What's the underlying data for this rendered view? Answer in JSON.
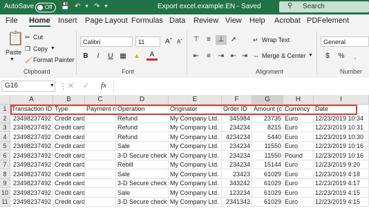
{
  "titlebar": {
    "autosave_label": "AutoSave",
    "autosave_state": "Off",
    "document_title": "Export excel.example.EN  -  Saved",
    "search_placeholder": "Search"
  },
  "menu": {
    "items": [
      "File",
      "Home",
      "Insert",
      "Page Layout",
      "Formulas",
      "Data",
      "Review",
      "View",
      "Help",
      "Acrobat",
      "PDFelement"
    ],
    "active": "Home"
  },
  "ribbon": {
    "clipboard": {
      "paste": "Paste",
      "cut": "Cut",
      "copy": "Copy",
      "format_painter": "Format Painter",
      "group_label": "Clipboard"
    },
    "font": {
      "family": "Calibri",
      "size": "11",
      "bold": "B",
      "italic": "I",
      "underline": "U",
      "font_color_glyph": "A",
      "group_label": "Font"
    },
    "alignment": {
      "wrap_text": "Wrap Text",
      "merge_center": "Merge & Center",
      "group_label": "Alignment"
    },
    "number": {
      "format": "General",
      "group_label": "Number"
    }
  },
  "formula_bar": {
    "name_box": "G16",
    "fx": "fx",
    "formula": ""
  },
  "sheet": {
    "columns": [
      "A",
      "B",
      "C",
      "D",
      "E",
      "F",
      "G",
      "H",
      "I"
    ],
    "selected_column": "G",
    "rows": [
      {
        "n": "1",
        "cells": [
          "Transaction ID",
          "Type",
          "Payment n",
          "Operation",
          "Originator",
          "Order ID",
          "Amount (c",
          "Currency",
          "Date"
        ]
      },
      {
        "n": "2",
        "cells": [
          "23498237492",
          "Credit card",
          "",
          "Refund",
          "My Company Ltd.",
          "345984",
          "23735",
          "Euro",
          "12/23/2019 10:34"
        ]
      },
      {
        "n": "3",
        "cells": [
          "23498237492",
          "Credit card",
          "",
          "Refund",
          "My Company Ltd.",
          "234234",
          "8215",
          "Euro",
          "12/23/2019 10:31"
        ]
      },
      {
        "n": "4",
        "cells": [
          "23498237492",
          "Credit card",
          "",
          "Refund",
          "My Company Ltd.",
          "4234234",
          "5440",
          "Euro",
          "12/23/2019 10:30"
        ]
      },
      {
        "n": "5",
        "cells": [
          "23498237492",
          "Credit card",
          "",
          "Sale",
          "My Company Ltd.",
          "234234",
          "11550",
          "Euro",
          "12/23/2019 10:16"
        ]
      },
      {
        "n": "6",
        "cells": [
          "23498237492",
          "Credit card",
          "",
          "3-D Secure check",
          "My Company Ltd.",
          "234234",
          "11550",
          "Pound",
          "12/23/2019 10:16"
        ]
      },
      {
        "n": "7",
        "cells": [
          "23498237492",
          "Credit card",
          "",
          "Rebill",
          "My Company Ltd.",
          "234234",
          "15144",
          "Euro",
          "12/23/2019 9:20"
        ]
      },
      {
        "n": "8",
        "cells": [
          "23498237492",
          "Credit card",
          "",
          "Sale",
          "My Company Ltd.",
          "23423",
          "61029",
          "Euro",
          "12/23/2019 4:18"
        ]
      },
      {
        "n": "9",
        "cells": [
          "23498237492",
          "Credit card",
          "",
          "3-D Secure check",
          "My Company Ltd.",
          "343242",
          "61029",
          "Euro",
          "12/23/2019 4:17"
        ]
      },
      {
        "n": "10",
        "cells": [
          "23498237492",
          "Credit card",
          "",
          "Sale",
          "My Company Ltd.",
          "123234",
          "61029",
          "Euro",
          "12/23/2019 4:15"
        ]
      },
      {
        "n": "11",
        "cells": [
          "23498237492",
          "Credit card",
          "",
          "3-D Secure check",
          "My Company Ltd.",
          "2341342",
          "61029",
          "Euro",
          "12/23/2019 4:15"
        ]
      }
    ]
  },
  "colors": {
    "brand": "#217346",
    "highlight_border": "#e03c3c"
  }
}
